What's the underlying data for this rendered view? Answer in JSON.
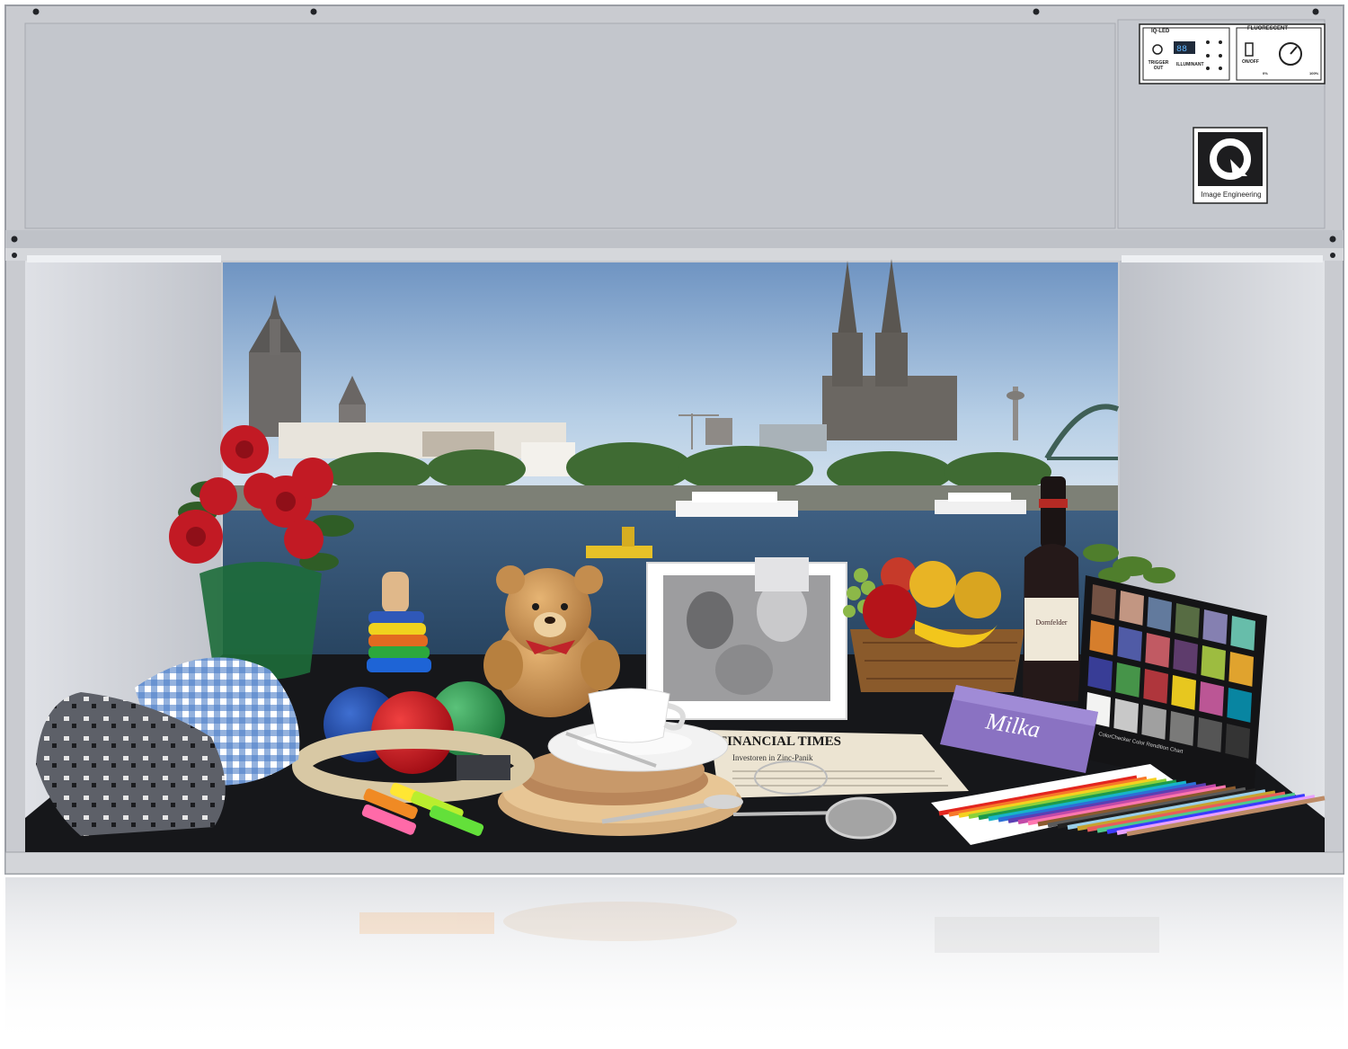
{
  "panel": {
    "ioled_label": "IQ-LED",
    "fluorescent_label": "FLUORESCENT",
    "trigger_label": "TRIGGER OUT",
    "illuminant_label": "ILLUMINANT",
    "onoff_label": "ON/OFF",
    "pct_min": "0%",
    "pct_max": "100%",
    "brand_name": "Image Engineering"
  },
  "props": {
    "newspaper_title": "FINANCIAL TIMES",
    "newspaper_headline": "Investoren in Zinc-Panik",
    "chocolate_brand": "Milka",
    "wine_label": "Dornfelder",
    "chart_caption": "ColorChecker Color Rendition Chart"
  },
  "colors": {
    "frame": "#c9cbd0",
    "sky": "#b7cfe6",
    "river": "#3c5d80",
    "table": "#16171a",
    "roses": "#c21a24"
  },
  "color_checker": [
    "#735244",
    "#c29682",
    "#627a9d",
    "#576c43",
    "#8580b1",
    "#67bdaa",
    "#d67e2c",
    "#505ba6",
    "#c15a63",
    "#5e3c6c",
    "#9dbc40",
    "#e0a32e",
    "#383d96",
    "#469449",
    "#af363c",
    "#e7c71f",
    "#bb5695",
    "#0885a1",
    "#f3f3f2",
    "#c8c8c8",
    "#a0a0a0",
    "#7a7a79",
    "#555555",
    "#343434"
  ]
}
